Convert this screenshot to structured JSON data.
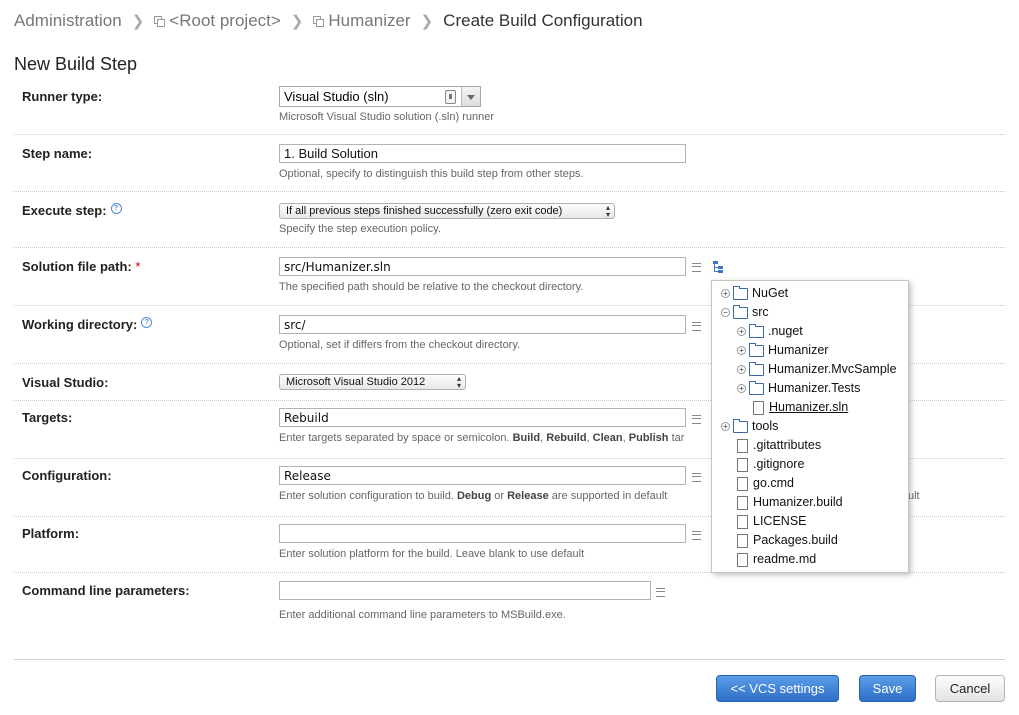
{
  "breadcrumb": {
    "administration": "Administration",
    "root_project": "<Root project>",
    "humanizer": "Humanizer",
    "current": "Create Build Configuration"
  },
  "page_title": "New Build Step",
  "fields": {
    "runner_type": {
      "label": "Runner type:",
      "value": "Visual Studio (sln)",
      "hint": "Microsoft Visual Studio solution (.sln) runner"
    },
    "step_name": {
      "label": "Step name:",
      "value": "1. Build Solution",
      "hint": "Optional, specify to distinguish this build step from other steps."
    },
    "execute_step": {
      "label": "Execute step:",
      "value": "If all previous steps finished successfully (zero exit code)",
      "hint": "Specify the step execution policy."
    },
    "solution_file_path": {
      "label": "Solution file path:",
      "required_mark": "*",
      "value": "src/Humanizer.sln",
      "hint": "The specified path should be relative to the checkout directory."
    },
    "working_directory": {
      "label": "Working directory:",
      "value": "src/",
      "hint": "Optional, set if differs from the checkout directory."
    },
    "visual_studio": {
      "label": "Visual Studio:",
      "value": "Microsoft Visual Studio 2012"
    },
    "targets": {
      "label": "Targets:",
      "value": "Rebuild",
      "hint_prefix": "Enter targets separated by space or semicolon.",
      "hint_bold": [
        "Build",
        "Rebuild",
        "Clean",
        "Publish"
      ],
      "hint_suffix": "tar"
    },
    "configuration": {
      "label": "Configuration:",
      "value": "Release",
      "hint_prefix": "Enter solution configuration to build.",
      "hint_bold_1": "Debug",
      "hint_or": "or",
      "hint_bold_2": "Release",
      "hint_suffix": "are supported in default",
      "hint_tail": "ult"
    },
    "platform": {
      "label": "Platform:",
      "value": "",
      "hint": "Enter solution platform for the build. Leave blank to use default"
    },
    "command_line": {
      "label": "Command line parameters:",
      "value": "",
      "hint": "Enter additional command line parameters to MSBuild.exe."
    }
  },
  "file_tree": [
    {
      "name": "NuGet",
      "type": "folder",
      "toggle": "+",
      "depth": 0
    },
    {
      "name": "src",
      "type": "folder",
      "toggle": "−",
      "depth": 0
    },
    {
      "name": ".nuget",
      "type": "folder",
      "toggle": "+",
      "depth": 1
    },
    {
      "name": "Humanizer",
      "type": "folder",
      "toggle": "+",
      "depth": 1
    },
    {
      "name": "Humanizer.MvcSample",
      "type": "folder",
      "toggle": "+",
      "depth": 1
    },
    {
      "name": "Humanizer.Tests",
      "type": "folder",
      "toggle": "+",
      "depth": 1
    },
    {
      "name": "Humanizer.sln",
      "type": "file",
      "toggle": "",
      "depth": 1,
      "selected": true
    },
    {
      "name": "tools",
      "type": "folder",
      "toggle": "+",
      "depth": 0
    },
    {
      "name": ".gitattributes",
      "type": "file",
      "toggle": "",
      "depth": 0
    },
    {
      "name": ".gitignore",
      "type": "file",
      "toggle": "",
      "depth": 0
    },
    {
      "name": "go.cmd",
      "type": "file",
      "toggle": "",
      "depth": 0
    },
    {
      "name": "Humanizer.build",
      "type": "file",
      "toggle": "",
      "depth": 0
    },
    {
      "name": "LICENSE",
      "type": "file",
      "toggle": "",
      "depth": 0
    },
    {
      "name": "Packages.build",
      "type": "file",
      "toggle": "",
      "depth": 0
    },
    {
      "name": "readme.md",
      "type": "file",
      "toggle": "",
      "depth": 0
    }
  ],
  "buttons": {
    "vcs_settings": "<< VCS settings",
    "save": "Save",
    "cancel": "Cancel"
  },
  "colors": {
    "primary_button": "#3a7fd6",
    "help_icon": "#4a8ed6",
    "required": "#cc0000"
  }
}
